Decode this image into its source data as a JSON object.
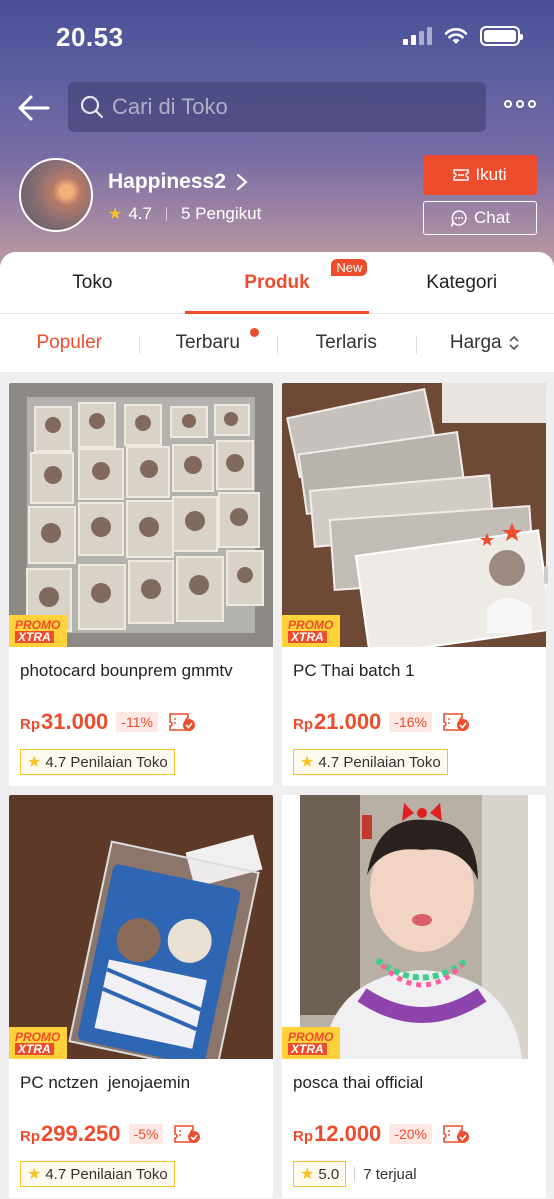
{
  "status": {
    "time": "20.53"
  },
  "search": {
    "placeholder": "Cari di Toko"
  },
  "shop": {
    "name": "Happiness2",
    "rating": "4.7",
    "followers": "5 Pengikut",
    "follow_label": "Ikuti",
    "chat_label": "Chat"
  },
  "tabs": [
    {
      "label": "Toko"
    },
    {
      "label": "Produk",
      "badge": "New"
    },
    {
      "label": "Kategori"
    }
  ],
  "sort": [
    {
      "label": "Populer"
    },
    {
      "label": "Terbaru"
    },
    {
      "label": "Terlaris"
    },
    {
      "label": "Harga"
    }
  ],
  "promo": {
    "line1": "PROMO",
    "line2": "XTRA"
  },
  "products": [
    {
      "title": "photocard bounprem gmmtv",
      "currency": "Rp",
      "price": "31.000",
      "discount": "-11%",
      "rating_label": "4.7 Penilaian Toko"
    },
    {
      "title": "PC Thai batch 1",
      "currency": "Rp",
      "price": "21.000",
      "discount": "-16%",
      "rating_label": "4.7 Penilaian Toko"
    },
    {
      "title": "PC nctzen  jenojaemin",
      "currency": "Rp",
      "price": "299.250",
      "discount": "-5%",
      "rating_label": "4.7 Penilaian Toko"
    },
    {
      "title": "posca thai official",
      "currency": "Rp",
      "price": "12.000",
      "discount": "-20%",
      "rating_label": "5.0",
      "sold": "7 terjual"
    }
  ],
  "colors": {
    "accent": "#ee4d2d",
    "star": "#f7c325",
    "promo_bg": "#ffd23c"
  }
}
